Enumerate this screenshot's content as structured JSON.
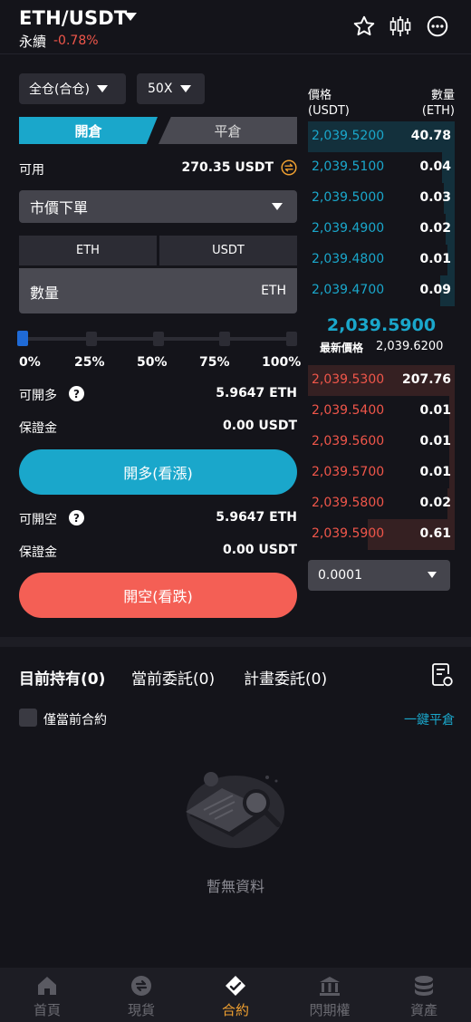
{
  "header": {
    "pair": "ETH/USDT",
    "contract_type": "永續",
    "change": "-0.78%"
  },
  "controls": {
    "margin_mode": "全仓(合仓)",
    "leverage": "50X",
    "tab_open": "開倉",
    "tab_close": "平倉",
    "available_label": "可用",
    "available_value": "270.35 USDT",
    "order_type": "市價下單",
    "unit_eth": "ETH",
    "unit_usdt": "USDT",
    "quantity_label": "數量",
    "quantity_unit": "ETH",
    "slider_value_pct": 0,
    "percent_marks": [
      "0%",
      "25%",
      "50%",
      "75%",
      "100%"
    ],
    "can_long_label": "可開多",
    "can_long_value": "5.9647 ETH",
    "margin_label": "保證金",
    "margin_long_value": "0.00 USDT",
    "btn_long": "開多(看漲)",
    "can_short_label": "可開空",
    "can_short_value": "5.9647 ETH",
    "margin_short_value": "0.00 USDT",
    "btn_short": "開空(看跌)",
    "help_glyph": "?"
  },
  "orderbook": {
    "price_header": "價格",
    "price_unit": "(USDT)",
    "qty_header": "數量",
    "qty_unit": "(ETH)",
    "bids": [
      {
        "price": "2,039.5200",
        "qty": "40.78"
      },
      {
        "price": "2,039.5100",
        "qty": "0.04"
      },
      {
        "price": "2,039.5000",
        "qty": "0.03"
      },
      {
        "price": "2,039.4900",
        "qty": "0.02"
      },
      {
        "price": "2,039.4800",
        "qty": "0.01"
      },
      {
        "price": "2,039.4700",
        "qty": "0.09"
      }
    ],
    "last_price": "2,039.5900",
    "mark_label": "最新價格",
    "mark_price": "2,039.6200",
    "asks": [
      {
        "price": "2,039.5300",
        "qty": "207.76"
      },
      {
        "price": "2,039.5400",
        "qty": "0.01"
      },
      {
        "price": "2,039.5600",
        "qty": "0.01"
      },
      {
        "price": "2,039.5700",
        "qty": "0.01"
      },
      {
        "price": "2,039.5800",
        "qty": "0.02"
      },
      {
        "price": "2,039.5900",
        "qty": "0.61"
      }
    ],
    "precision": "0.0001"
  },
  "positions": {
    "tab_holdings": "目前持有(0)",
    "tab_orders": "當前委託(0)",
    "tab_plans": "計畫委託(0)",
    "only_current_label": "僅當前合約",
    "close_all": "一鍵平倉",
    "empty_text": "暫無資料"
  },
  "nav": {
    "items": [
      {
        "label": "首頁",
        "icon": "home-icon"
      },
      {
        "label": "現貨",
        "icon": "spot-icon"
      },
      {
        "label": "合約",
        "icon": "contract-icon"
      },
      {
        "label": "閃期權",
        "icon": "options-icon"
      },
      {
        "label": "資產",
        "icon": "assets-icon"
      }
    ],
    "active": "合約"
  },
  "colors": {
    "accent": "#1aa7cb",
    "down": "#f0564a",
    "short_button": "#f45f55",
    "nav_active": "#f0a030"
  }
}
